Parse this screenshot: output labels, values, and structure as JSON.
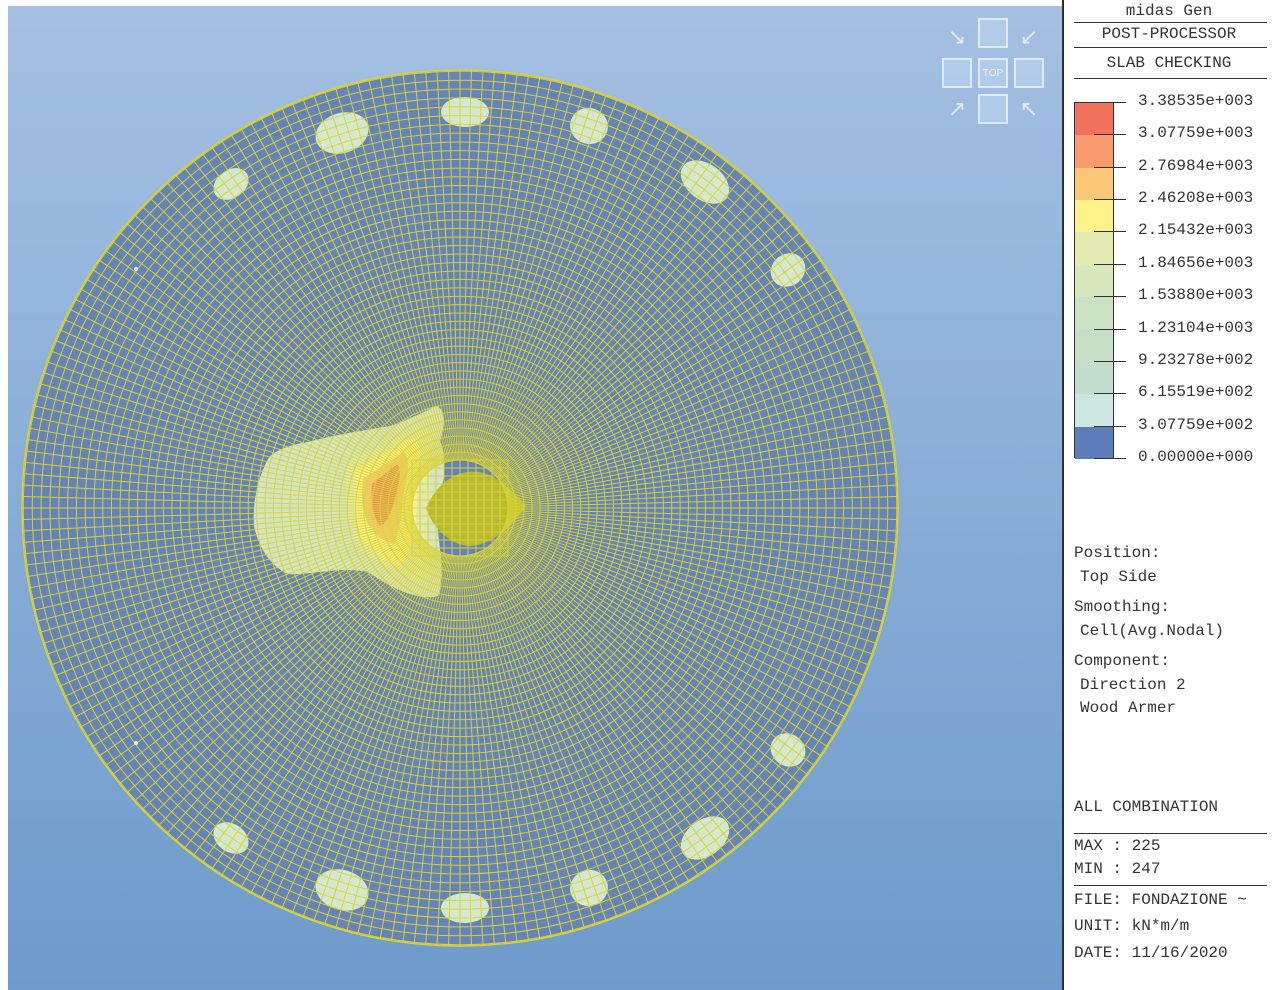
{
  "panel": {
    "app_name": "midas Gen",
    "module": "POST-PROCESSOR",
    "result_type": "SLAB CHECKING",
    "legend_values": [
      "3.38535e+003",
      "3.07759e+003",
      "2.76984e+003",
      "2.46208e+003",
      "2.15432e+003",
      "1.84656e+003",
      "1.53880e+003",
      "1.23104e+003",
      "9.23278e+002",
      "6.15519e+002",
      "3.07759e+002",
      "0.00000e+000"
    ],
    "legend_colors": [
      "#f0715c",
      "#f79a6e",
      "#fbc776",
      "#fdf18a",
      "#e3ebb0",
      "#d6e7bc",
      "#cbe2c2",
      "#c4dfc6",
      "#c2ddcb",
      "#cde6e2",
      "#5f7cba"
    ],
    "position_label": "Position:",
    "position_value": "Top Side",
    "smoothing_label": "Smoothing:",
    "smoothing_value": "Cell(Avg.Nodal)",
    "component_label": "Component:",
    "component_value_1": "Direction 2",
    "component_value_2": "Wood Armer",
    "combination": "ALL COMBINATION",
    "max_label": "MAX : 225",
    "min_label": "MIN : 247",
    "file_label": "FILE: FONDAZIONE ~",
    "unit_label": "UNIT: kN*m/m",
    "date_label": "DATE: 11/16/2020"
  },
  "view_cube": {
    "face_label": "TOP"
  },
  "colors": {
    "mesh": "#d9d337",
    "slab": "#6583b5",
    "center": "#b8b930"
  }
}
